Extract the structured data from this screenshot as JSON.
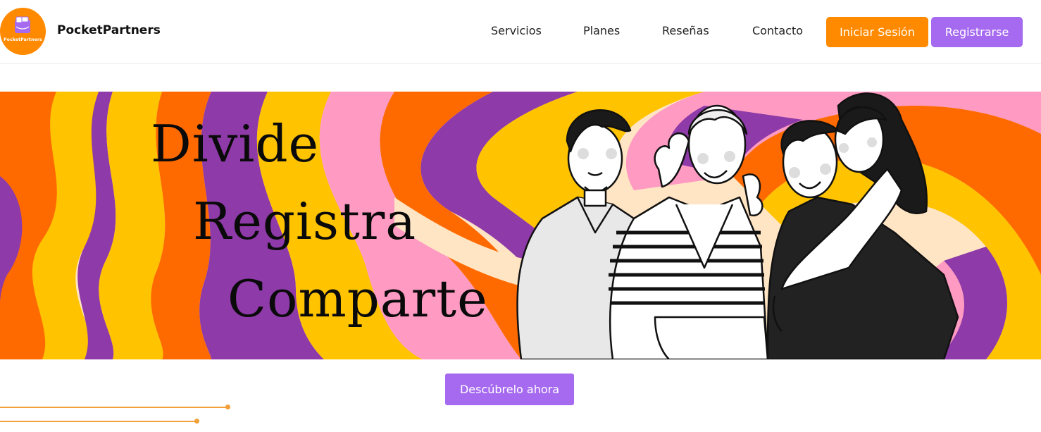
{
  "brand": {
    "name": "PocketPartners",
    "logo_caption": "PocketPartners"
  },
  "nav": {
    "items": [
      {
        "label": "Servicios"
      },
      {
        "label": "Planes"
      },
      {
        "label": "Reseñas"
      },
      {
        "label": "Contacto"
      }
    ],
    "login_label": "Iniciar Sesión",
    "register_label": "Registrarse"
  },
  "hero": {
    "words": [
      "Divide",
      "Registra",
      "Comparte"
    ],
    "illustration": "four-friends-illustration",
    "background": "psychedelic-wave-pattern"
  },
  "cta": {
    "label": "Descúbrelo ahora"
  },
  "colors": {
    "orange": "#ff8a00",
    "purple": "#a66af0",
    "wave_purple": "#8e3aa8",
    "wave_orange": "#ff6a00",
    "wave_yellow": "#ffc300",
    "wave_pink": "#ff9ac2",
    "wave_cream": "#ffe5c4"
  }
}
